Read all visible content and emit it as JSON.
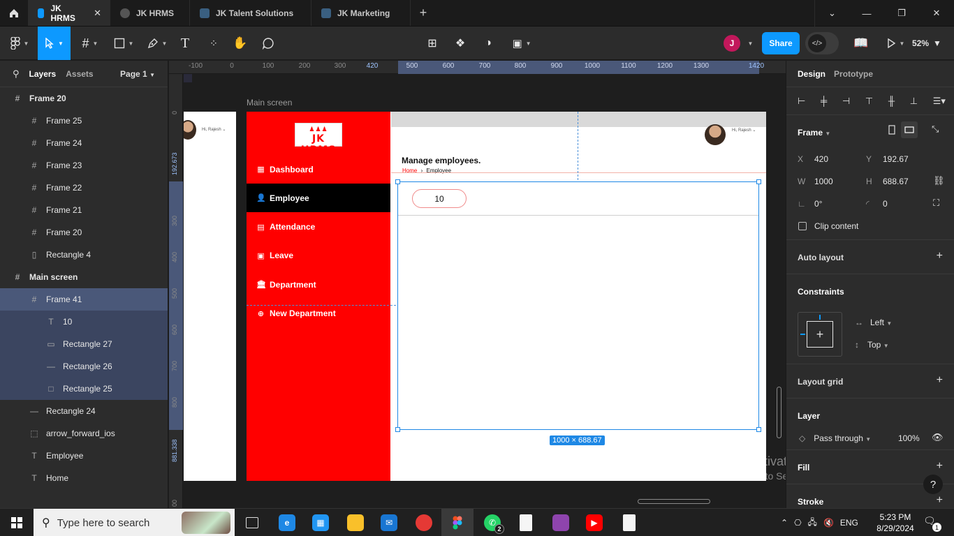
{
  "tabs": [
    {
      "title": "JK HRMS",
      "icon": "figma-file-icon",
      "active": true
    },
    {
      "title": "JK HRMS",
      "icon": "prototype-play-icon",
      "active": false
    },
    {
      "title": "JK Talent Solutions",
      "icon": "figma-file-icon",
      "active": false
    },
    {
      "title": "JK Marketing",
      "icon": "figma-file-icon",
      "active": false
    }
  ],
  "toolbar": {
    "user_initial": "J",
    "user_color": "#c2185b",
    "share_label": "Share",
    "dev_mode_icon": "</>",
    "zoom": "52%",
    "accent": "#0d99ff"
  },
  "left_panel": {
    "tabs": {
      "layers": "Layers",
      "assets": "Assets"
    },
    "page": "Page 1",
    "layers": [
      {
        "name": "Frame 20",
        "type": "frame",
        "indent": 0,
        "bold": true,
        "state": ""
      },
      {
        "name": "Frame 25",
        "type": "frame",
        "indent": 1,
        "bold": false,
        "state": ""
      },
      {
        "name": "Frame 24",
        "type": "frame",
        "indent": 1,
        "bold": false,
        "state": ""
      },
      {
        "name": "Frame 23",
        "type": "frame",
        "indent": 1,
        "bold": false,
        "state": ""
      },
      {
        "name": "Frame 22",
        "type": "frame",
        "indent": 1,
        "bold": false,
        "state": ""
      },
      {
        "name": "Frame 21",
        "type": "frame",
        "indent": 1,
        "bold": false,
        "state": ""
      },
      {
        "name": "Frame 20",
        "type": "frame",
        "indent": 1,
        "bold": false,
        "state": ""
      },
      {
        "name": "Rectangle 4",
        "type": "rect-tall",
        "indent": 1,
        "bold": false,
        "state": ""
      },
      {
        "name": "Main screen",
        "type": "frame",
        "indent": 0,
        "bold": true,
        "state": ""
      },
      {
        "name": "Frame 41",
        "type": "frame",
        "indent": 1,
        "bold": false,
        "state": "selected"
      },
      {
        "name": "10",
        "type": "text",
        "indent": 2,
        "bold": false,
        "state": "child"
      },
      {
        "name": "Rectangle 27",
        "type": "pill",
        "indent": 2,
        "bold": false,
        "state": "child"
      },
      {
        "name": "Rectangle 26",
        "type": "line",
        "indent": 2,
        "bold": false,
        "state": "child"
      },
      {
        "name": "Rectangle 25",
        "type": "rect",
        "indent": 2,
        "bold": false,
        "state": "child"
      },
      {
        "name": "Rectangle 24",
        "type": "line",
        "indent": 1,
        "bold": false,
        "state": ""
      },
      {
        "name": "arrow_forward_ios",
        "type": "dotted",
        "indent": 1,
        "bold": false,
        "state": ""
      },
      {
        "name": "Employee",
        "type": "text",
        "indent": 1,
        "bold": false,
        "state": ""
      },
      {
        "name": "Home",
        "type": "text",
        "indent": 1,
        "bold": false,
        "state": ""
      }
    ]
  },
  "rulers": {
    "top": [
      "-100",
      "0",
      "100",
      "200",
      "300",
      "420",
      "500",
      "600",
      "700",
      "800",
      "900",
      "1000",
      "1100",
      "1200",
      "1300",
      "1420"
    ],
    "left": [
      "0",
      "192.673",
      "300",
      "400",
      "500",
      "600",
      "700",
      "800",
      "881.338",
      "00"
    ]
  },
  "canvas": {
    "frame_label": "Main screen",
    "left_frame_greeting": "Hi, Rajesh ⌄",
    "app": {
      "logo_text": "JK HRMS",
      "nav": [
        {
          "label": "Dashboard",
          "icon": "dashboard-icon",
          "active": false
        },
        {
          "label": "Employee",
          "icon": "person-icon",
          "active": true
        },
        {
          "label": "Attendance",
          "icon": "calendar-grid-icon",
          "active": false
        },
        {
          "label": "Leave",
          "icon": "calendar-leave-icon",
          "active": false
        },
        {
          "label": "Department",
          "icon": "building-icon",
          "active": false
        },
        {
          "label": "New Department",
          "icon": "plus-circle-icon",
          "active": false
        }
      ],
      "page_heading": "Manage employees.",
      "breadcrumb": {
        "home": "Home",
        "separator": "›",
        "current": "Employee"
      },
      "greeting": "Hi, Rajesh ⌄",
      "pill_value": "10",
      "sidebar_color": "#ff0000"
    },
    "selection_size": "1000 × 688.67",
    "watermark": {
      "line1": "Activate Windows",
      "line2": "Go to Settings to activate Windows."
    }
  },
  "right_panel": {
    "tabs": {
      "design": "Design",
      "prototype": "Prototype"
    },
    "frame_title": "Frame",
    "x_label": "X",
    "x": "420",
    "y_label": "Y",
    "y": "192.67",
    "w_label": "W",
    "w": "1000",
    "h_label": "H",
    "h": "688.67",
    "rotation": "0°",
    "radius": "0",
    "clip_content": "Clip content",
    "auto_layout": "Auto layout",
    "constraints": "Constraints",
    "constraint_h": "Left",
    "constraint_v": "Top",
    "layout_grid": "Layout grid",
    "layer_title": "Layer",
    "blend_mode": "Pass through",
    "opacity": "100%",
    "fill": "Fill",
    "stroke": "Stroke",
    "help": "?"
  },
  "taskbar": {
    "search_placeholder": "Type here to search",
    "apps": [
      {
        "name": "task-view",
        "label": "",
        "color": "#202020",
        "badge": ""
      },
      {
        "name": "edge",
        "label": "e",
        "color": "#1e88e5",
        "badge": ""
      },
      {
        "name": "store",
        "label": "▦",
        "color": "#2196f3",
        "badge": ""
      },
      {
        "name": "file-explorer",
        "label": "",
        "color": "#f9c02a",
        "badge": ""
      },
      {
        "name": "mail",
        "label": "✉",
        "color": "#1976d2",
        "badge": ""
      },
      {
        "name": "chrome",
        "label": "",
        "color": "#e53935",
        "badge": ""
      },
      {
        "name": "figma",
        "label": "",
        "color": "#3a3a3a",
        "badge": ""
      },
      {
        "name": "whatsapp",
        "label": "✆",
        "color": "#25d366",
        "badge": "2"
      },
      {
        "name": "document",
        "label": "",
        "color": "#f5f5f5",
        "badge": ""
      },
      {
        "name": "github-desktop",
        "label": "",
        "color": "#8e44ad",
        "badge": ""
      },
      {
        "name": "youtube",
        "label": "▶",
        "color": "#ff0000",
        "badge": ""
      },
      {
        "name": "document-2",
        "label": "",
        "color": "#f5f5f5",
        "badge": ""
      }
    ],
    "language": "ENG",
    "time": "5:23 PM",
    "date": "8/29/2024",
    "notifications": "1"
  }
}
